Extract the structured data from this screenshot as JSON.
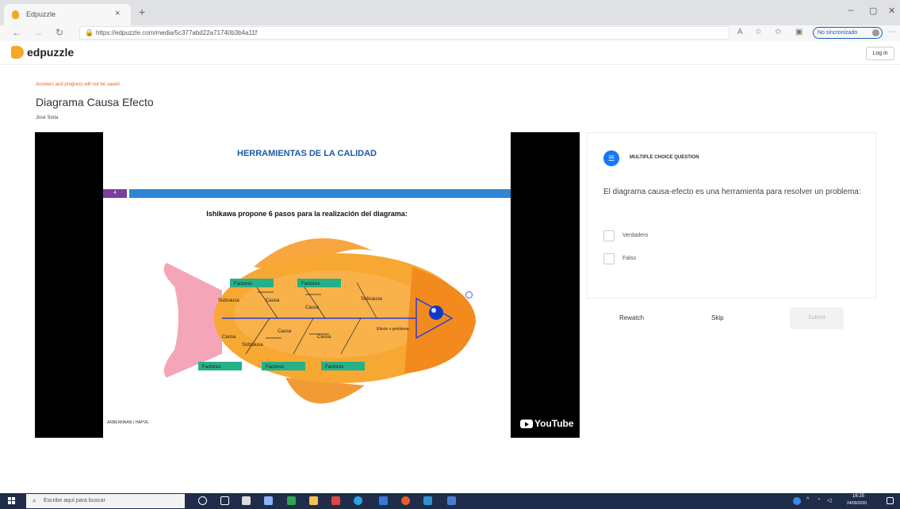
{
  "browser": {
    "tab_title": "Edpuzzle",
    "tab_close": "×",
    "new_tab": "+",
    "url": "https://edpuzzle.com/media/5c377abd22a71740b3b4a11f",
    "no_sync": "No sincronizado",
    "controls": {
      "minimize": "–",
      "maximize": "▢",
      "close": "✕"
    }
  },
  "app": {
    "logo": "edpuzzle",
    "login_label": "Log in"
  },
  "page": {
    "warning": "Answers and progress will not be saved",
    "title": "Diagrama Causa Efecto",
    "author": "José Soria"
  },
  "video": {
    "slide_title": "HERRAMIENTAS DE LA CALIDAD",
    "slide_number": "4",
    "slide_subtitle": "Ishikawa propone 6 pasos para la realización del diagrama:",
    "fish_labels": {
      "factores": "Factores",
      "subcausa": "Subcausa",
      "causa": "Causa",
      "efecto": "Efecto o problema"
    },
    "footer": "ARBENNNAN  |  HAPVE",
    "youtube": "YouTube"
  },
  "question": {
    "type": "MULTIPLE CHOICE QUESTION",
    "text": "El diagrama causa-efecto es una herramienta para resolver un problema:",
    "options": [
      "Verdadero",
      "Falso"
    ],
    "rewatch_label": "Rewatch",
    "skip_label": "Skip",
    "submit_label": "Submit"
  },
  "taskbar": {
    "search_placeholder": "Escribe aquí para buscar",
    "time": "16:25",
    "date": "24/09/2020"
  }
}
